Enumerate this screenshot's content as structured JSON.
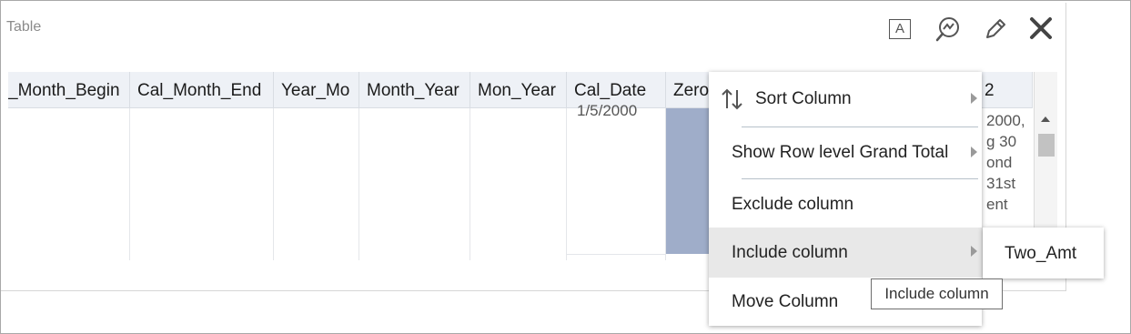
{
  "view": {
    "title": "Table"
  },
  "toolbar": {
    "format_icon_glyph": "A",
    "icons": [
      "format-text-icon",
      "analyze-icon",
      "pencil-edit-icon",
      "close-icon"
    ]
  },
  "table": {
    "columns": [
      "_Month_Begin",
      "Cal_Month_End",
      "Year_Mo",
      "Month_Year",
      "Mon_Year",
      "Cal_Date",
      "Zero",
      "2"
    ],
    "cal_date_cell": "1/5/2000",
    "last_col_lines": [
      "2000,",
      "g 30",
      "ond",
      "31st",
      "ent"
    ]
  },
  "context_menu": {
    "items": [
      {
        "label": "Sort Column",
        "submenu": true
      },
      {
        "label": "Show Row level Grand Total",
        "submenu": true
      },
      {
        "label": "Exclude column",
        "submenu": false
      },
      {
        "label": "Include column",
        "submenu": true,
        "highlighted": true
      },
      {
        "label": "Move Column",
        "submenu": false
      }
    ]
  },
  "submenu": {
    "items": [
      "Two_Amt"
    ]
  },
  "tooltip": {
    "text": "Include column"
  },
  "colors": {
    "header_bg": "#eef1f6",
    "selected_column": "#9fadc9",
    "menu_highlight": "#e8e8e8",
    "separator": "#b7c1ca"
  }
}
